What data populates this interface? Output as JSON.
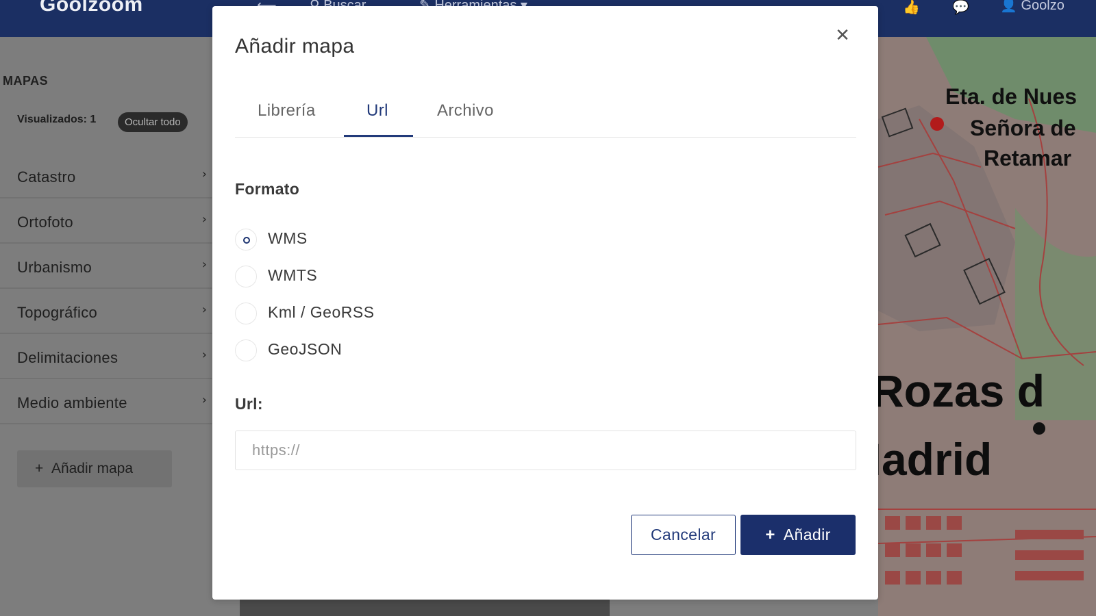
{
  "app": {
    "logo": "Goolzoom"
  },
  "topbar": {
    "search_label": "Buscar",
    "tools_label": "Herramientas",
    "user_label": "Goolzo"
  },
  "sidebar": {
    "title": "MAPAS",
    "visible_count_label": "Visualizados: 1",
    "hide_all_label": "Ocultar todo",
    "items": [
      {
        "label": "Catastro"
      },
      {
        "label": "Ortofoto"
      },
      {
        "label": "Urbanismo"
      },
      {
        "label": "Topográfico"
      },
      {
        "label": "Delimitaciones"
      },
      {
        "label": "Medio ambiente"
      }
    ],
    "add_map_label": "Añadir mapa"
  },
  "map": {
    "labels": [
      "Eta. de Nues",
      "Señora de",
      "Retamar",
      "Rozas d",
      "Madrid"
    ]
  },
  "modal": {
    "title": "Añadir mapa",
    "close_icon": "close-icon",
    "tabs": [
      {
        "label": "Librería",
        "active": false
      },
      {
        "label": "Url",
        "active": true
      },
      {
        "label": "Archivo",
        "active": false
      }
    ],
    "format_label": "Formato",
    "formats": [
      {
        "label": "WMS",
        "checked": true
      },
      {
        "label": "WMTS",
        "checked": false
      },
      {
        "label": "Kml / GeoRSS",
        "checked": false
      },
      {
        "label": "GeoJSON",
        "checked": false
      }
    ],
    "url_label": "Url:",
    "url_placeholder": "https://",
    "url_value": "",
    "cancel_label": "Cancelar",
    "add_label": "Añadir"
  },
  "colors": {
    "primary": "#1b2f6b",
    "accent": "#223a7a",
    "overlay": "#7d7d7d"
  }
}
